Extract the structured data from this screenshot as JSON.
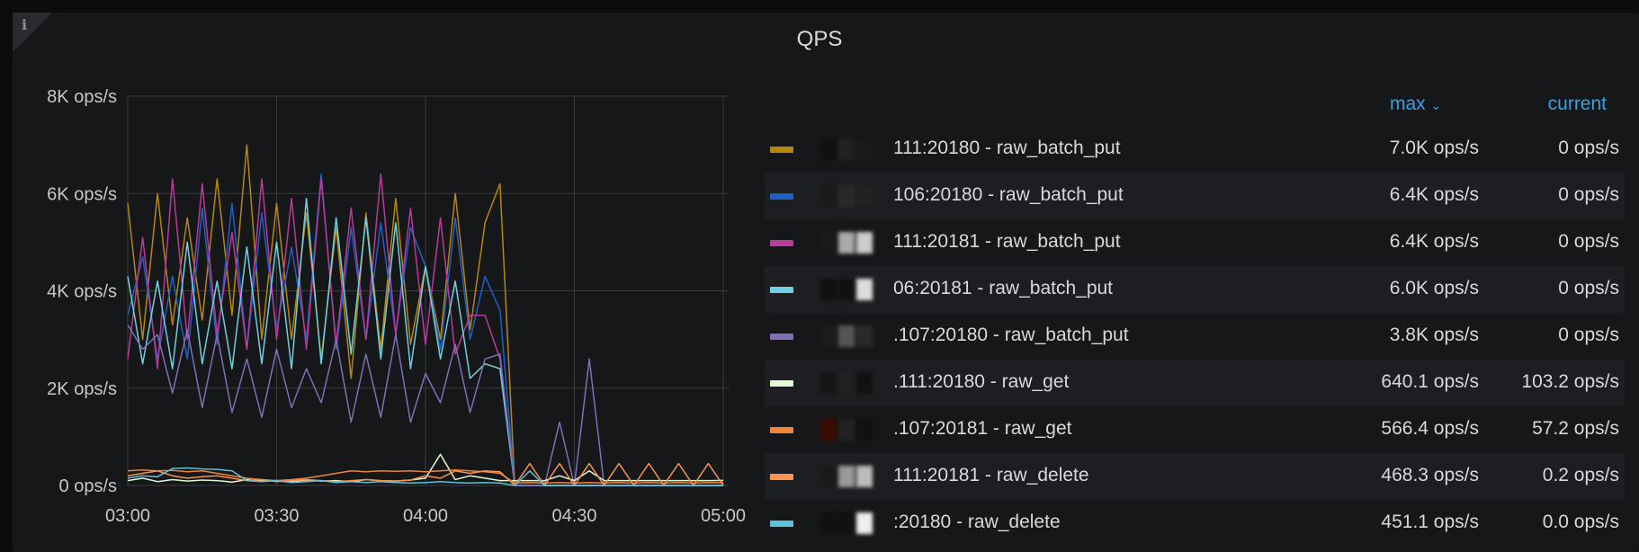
{
  "panel": {
    "title": "QPS",
    "info_icon": "i"
  },
  "legend": {
    "headers": {
      "max": "max",
      "current": "current",
      "sort_icon": "chevron-down"
    },
    "rows": [
      {
        "name": "111:20180 - raw_batch_put",
        "max": "7.0K ops/s",
        "current": "0 ops/s",
        "color": "#b8860b"
      },
      {
        "name": "106:20180 - raw_batch_put",
        "max": "6.4K ops/s",
        "current": "0 ops/s",
        "color": "#1f60c4"
      },
      {
        "name": "111:20181 - raw_batch_put",
        "max": "6.4K ops/s",
        "current": "0 ops/s",
        "color": "#b93a9a"
      },
      {
        "name": "06:20181 - raw_batch_put",
        "max": "6.0K ops/s",
        "current": "0 ops/s",
        "color": "#6ed0e0"
      },
      {
        "name": ".107:20180 - raw_batch_put",
        "max": "3.8K ops/s",
        "current": "0 ops/s",
        "color": "#806eb7"
      },
      {
        "name": ".111:20180 - raw_get",
        "max": "640.1 ops/s",
        "current": "103.2 ops/s",
        "color": "#e0f9d7"
      },
      {
        "name": ".107:20181 - raw_get",
        "max": "566.4 ops/s",
        "current": "57.2 ops/s",
        "color": "#ef843c"
      },
      {
        "name": "111:20181 - raw_delete",
        "max": "468.3 ops/s",
        "current": "0.2 ops/s",
        "color": "#f9934e"
      },
      {
        "name": ":20180 - raw_delete",
        "max": "451.1 ops/s",
        "current": "0.0 ops/s",
        "color": "#5bc2da"
      }
    ]
  },
  "chart_data": {
    "type": "line",
    "title": "QPS",
    "xlabel": "",
    "ylabel": "",
    "x_ticks": [
      "03:00",
      "03:30",
      "04:00",
      "04:30",
      "05:00"
    ],
    "y_ticks": [
      "0 ops/s",
      "2K ops/s",
      "4K ops/s",
      "6K ops/s",
      "8K ops/s"
    ],
    "ylim": [
      0,
      8000
    ],
    "x_range_minutes": [
      0,
      120
    ],
    "x_step_minutes": 3,
    "grid": true,
    "series": [
      {
        "name": "111:20180 - raw_batch_put",
        "color": "#b8860b",
        "values": [
          5800,
          3000,
          6000,
          3300,
          5500,
          3400,
          6300,
          3500,
          7000,
          3000,
          5800,
          3000,
          5600,
          2600,
          5300,
          2200,
          5600,
          2800,
          5900,
          2900,
          4500,
          3000,
          6000,
          3200,
          5400,
          6200,
          0,
          0,
          0,
          0,
          0,
          0,
          0,
          0,
          0,
          0,
          0,
          0,
          0,
          0,
          0
        ]
      },
      {
        "name": "106:20180 - raw_batch_put",
        "color": "#1f60c4",
        "values": [
          3500,
          4700,
          2600,
          4300,
          2600,
          5700,
          2900,
          5800,
          2800,
          5600,
          3200,
          4900,
          3000,
          6400,
          2800,
          5300,
          3000,
          5400,
          3100,
          5300,
          4500,
          2800,
          5500,
          3000,
          4300,
          3600,
          0,
          0,
          0,
          0,
          0,
          0,
          0,
          0,
          0,
          0,
          0,
          0,
          0,
          0,
          0
        ]
      },
      {
        "name": "111:20181 - raw_batch_put",
        "color": "#b93a9a",
        "values": [
          2600,
          5100,
          2400,
          6300,
          3000,
          6200,
          3100,
          5200,
          2800,
          6300,
          3000,
          5900,
          2800,
          6300,
          2900,
          5700,
          3000,
          6400,
          3100,
          5700,
          2900,
          5500,
          2700,
          3500,
          3500,
          2600,
          0,
          0,
          0,
          0,
          0,
          0,
          0,
          0,
          0,
          0,
          0,
          0,
          0,
          0,
          0
        ]
      },
      {
        "name": "06:20181 - raw_batch_put",
        "color": "#6ed0e0",
        "values": [
          4300,
          2500,
          4200,
          2400,
          5000,
          2500,
          4200,
          2400,
          4900,
          2500,
          5000,
          2400,
          5900,
          2500,
          5500,
          2700,
          5500,
          2600,
          5400,
          2400,
          4500,
          2600,
          4200,
          2200,
          2500,
          2400,
          0,
          0,
          0,
          0,
          0,
          0,
          0,
          0,
          0,
          0,
          0,
          0,
          0,
          0,
          0
        ]
      },
      {
        "name": ".107:20180 - raw_batch_put",
        "color": "#806eb7",
        "values": [
          3300,
          2800,
          3100,
          1900,
          3200,
          1600,
          3100,
          1500,
          2600,
          1400,
          2800,
          1600,
          2400,
          1700,
          3000,
          1300,
          2700,
          1400,
          3100,
          1300,
          2300,
          1700,
          2900,
          1500,
          2600,
          2700,
          0,
          0,
          0,
          1300,
          0,
          2600,
          0,
          0,
          0,
          0,
          0,
          0,
          0,
          0,
          0
        ]
      },
      {
        "name": ".111:20180 - raw_get",
        "color": "#e0f9d7",
        "values": [
          100,
          150,
          80,
          120,
          90,
          110,
          100,
          70,
          120,
          90,
          100,
          80,
          110,
          90,
          100,
          80,
          120,
          100,
          90,
          110,
          150,
          640,
          120,
          200,
          150,
          100,
          100,
          100,
          100,
          200,
          100,
          300,
          100,
          100,
          100,
          100,
          100,
          100,
          100,
          100,
          103
        ]
      },
      {
        "name": ".107:20181 - raw_get",
        "color": "#ef843c",
        "values": [
          300,
          320,
          300,
          310,
          280,
          300,
          250,
          200,
          150,
          120,
          100,
          120,
          150,
          200,
          250,
          300,
          280,
          300,
          290,
          300,
          280,
          300,
          320,
          300,
          280,
          250,
          50,
          60,
          50,
          60,
          50,
          60,
          50,
          60,
          50,
          60,
          50,
          60,
          50,
          60,
          57
        ]
      },
      {
        "name": "111:20181 - raw_delete",
        "color": "#f9934e",
        "values": [
          200,
          250,
          300,
          200,
          150,
          180,
          200,
          150,
          100,
          120,
          80,
          100,
          120,
          100,
          80,
          100,
          120,
          100,
          90,
          110,
          200,
          150,
          300,
          250,
          300,
          280,
          0,
          450,
          0,
          450,
          0,
          450,
          0,
          450,
          0,
          450,
          0,
          450,
          0,
          450,
          0
        ]
      },
      {
        "name": ":20180 - raw_delete",
        "color": "#5bc2da",
        "values": [
          150,
          200,
          180,
          350,
          360,
          340,
          330,
          300,
          100,
          80,
          100,
          60,
          80,
          100,
          60,
          80,
          60,
          80,
          60,
          50,
          60,
          80,
          60,
          50,
          60,
          50,
          0,
          300,
          0,
          0,
          0,
          0,
          0,
          0,
          0,
          0,
          0,
          0,
          0,
          0,
          0
        ]
      }
    ]
  }
}
